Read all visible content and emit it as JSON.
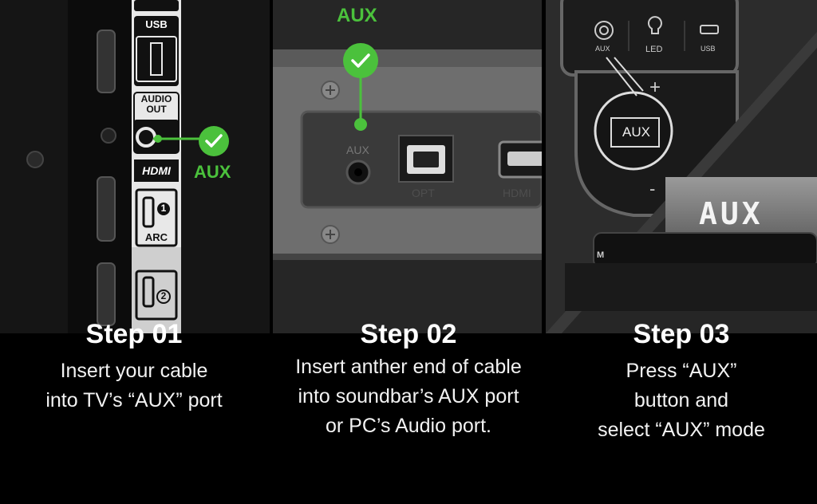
{
  "colors": {
    "accent": "#4bc13c"
  },
  "steps": [
    {
      "title": "Step 01",
      "lines": [
        "Insert your cable",
        "into TV’s “AUX” port"
      ]
    },
    {
      "title": "Step 02",
      "lines": [
        "Insert anther end of cable",
        "into soundbar’s AUX port",
        "or PC’s Audio port."
      ]
    },
    {
      "title": "Step 03",
      "lines": [
        "Press “AUX”",
        "button and",
        "select “AUX” mode"
      ]
    }
  ],
  "panel1": {
    "port_usb": "USB",
    "port_audio_out_1": "AUDIO",
    "port_audio_out_2": "OUT",
    "port_hdmi": "HDMI",
    "port_hdmi_1_num": "1",
    "port_arc": "ARC",
    "port_hdmi_2_num": "2",
    "callout": "AUX"
  },
  "panel2": {
    "callout": "AUX",
    "port_aux": "AUX",
    "port_opt": "OPT",
    "port_hdmi": "HDMI"
  },
  "panel3": {
    "remote_aux": "AUX",
    "remote_led": "LED",
    "remote_usb": "USB",
    "remote_plus": "+",
    "remote_minus": "-",
    "zoom_aux": "AUX",
    "display": "AUX",
    "remote_m": "M"
  },
  "icons": [
    "check-icon",
    "audio-jack-icon",
    "bulb-icon",
    "usb-icon",
    "hdmi-port-icon",
    "optical-port-icon"
  ]
}
